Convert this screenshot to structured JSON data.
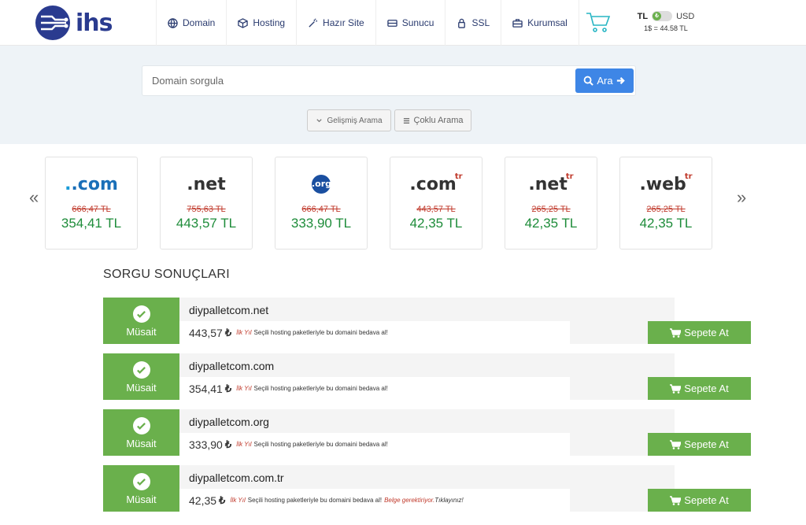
{
  "brand": {
    "name": "ihs"
  },
  "nav": [
    {
      "label": "Domain",
      "icon": "globe-icon"
    },
    {
      "label": "Hosting",
      "icon": "cube-icon"
    },
    {
      "label": "Hazır Site",
      "icon": "wand-icon"
    },
    {
      "label": "Sunucu",
      "icon": "server-icon"
    },
    {
      "label": "SSL",
      "icon": "lock-icon"
    },
    {
      "label": "Kurumsal",
      "icon": "briefcase-icon"
    }
  ],
  "currency": {
    "left": "TL",
    "right": "USD",
    "rate": "1$ = 44.58 TL",
    "toggle_symbol": "₺"
  },
  "search": {
    "placeholder": "Domain sorgula",
    "button": "Ara",
    "advanced": "Gelişmiş Arama",
    "bulk": "Çoklu Arama"
  },
  "tlds": [
    {
      "name": ".com",
      "tr": "",
      "old": "666,47 TL",
      "new": "354,41 TL"
    },
    {
      "name": ".net",
      "tr": "",
      "old": "755,63 TL",
      "new": "443,57 TL"
    },
    {
      "name": ".org",
      "tr": "",
      "old": "666,47 TL",
      "new": "333,90 TL"
    },
    {
      "name": ".com",
      "tr": "tr",
      "old": "443,57 TL",
      "new": "42,35 TL"
    },
    {
      "name": ".net",
      "tr": "tr",
      "old": "265,25 TL",
      "new": "42,35 TL"
    },
    {
      "name": ".web",
      "tr": "tr",
      "old": "265,25 TL",
      "new": "42,35 TL"
    }
  ],
  "carousel": {
    "prev": "«",
    "next": "»"
  },
  "results": {
    "title": "SORGU SONUÇLARI",
    "status": "Müsait",
    "cart_label": "Sepete At",
    "currency_symbol": "₺",
    "year_label": "İlk Yıl",
    "promo": "Seçili hosting paketleriyle bu domaini bedava al!",
    "items": [
      {
        "domain": "diypalletcom.net",
        "price": "443,57"
      },
      {
        "domain": "diypalletcom.com",
        "price": "354,41"
      },
      {
        "domain": "diypalletcom.org",
        "price": "333,90"
      },
      {
        "domain": "diypalletcom.com.tr",
        "price": "42,35",
        "doc_note": "Belge gerektiriyor.",
        "click_note": "Tıklayınız!"
      }
    ]
  },
  "colors": {
    "brand_blue": "#2a3b8f",
    "search_blue": "#3e86e6",
    "green": "#6ab04c",
    "price_green": "#1e8c3a",
    "strike_red": "#c0392b",
    "band": "#eef3f7"
  }
}
